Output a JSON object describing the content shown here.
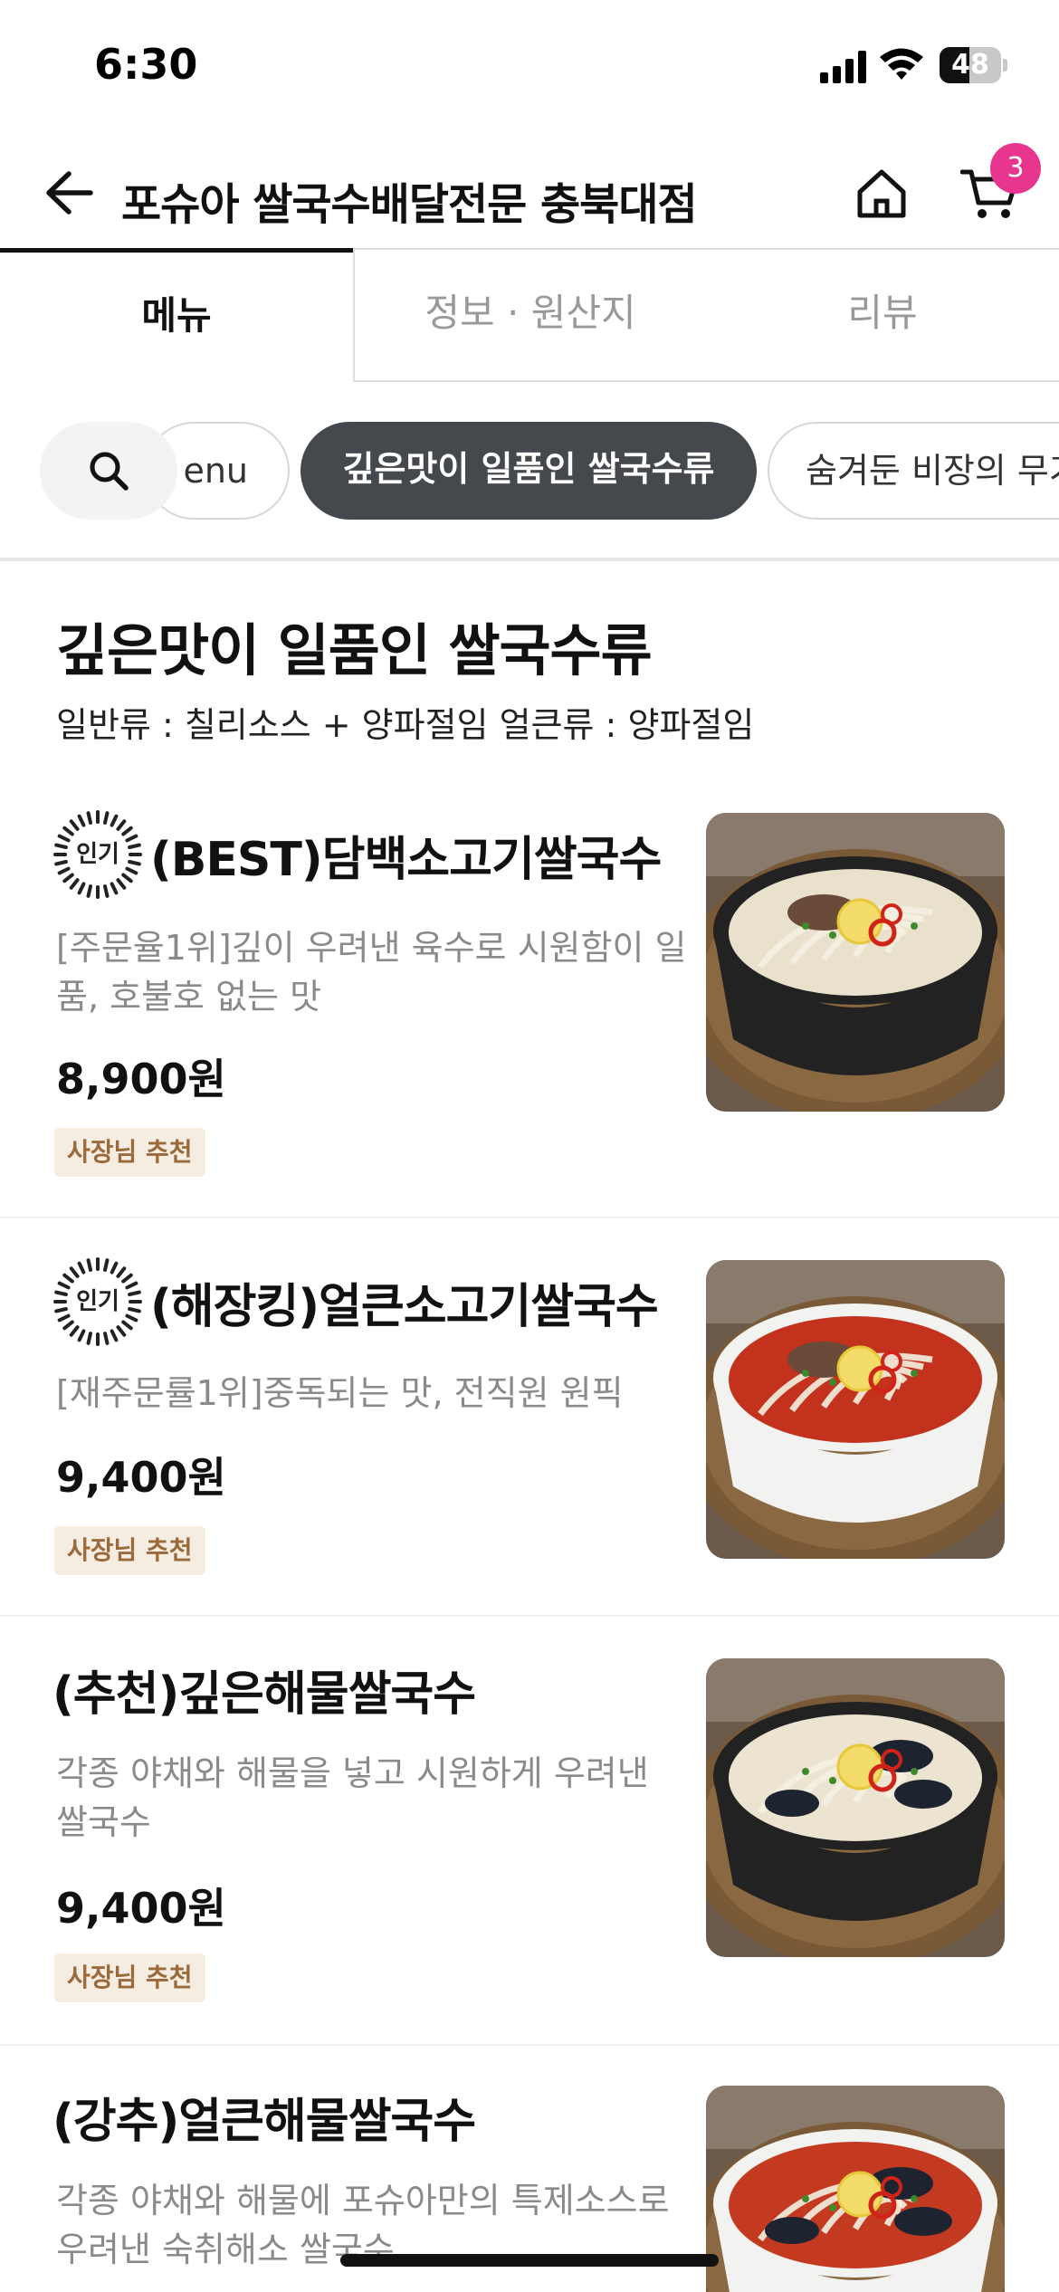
{
  "status_bar": {
    "time": "6:30",
    "battery": "48",
    "battery_level": 0.48
  },
  "header": {
    "store_name": "포슈아 쌀국수배달전문 충북대점",
    "cart_count": "3"
  },
  "tabs": [
    {
      "label": "메뉴",
      "active": true
    },
    {
      "label": "정보 · 원산지",
      "active": false
    },
    {
      "label": "리뷰",
      "active": false
    }
  ],
  "chips": {
    "prev_label": "enu",
    "active_label": "깊은맛이 일품인 쌀국수류",
    "next_label": "숨겨둔 비장의 무기"
  },
  "section": {
    "title": "깊은맛이 일품인 쌀국수류",
    "description": "일반류 : 칠리소스 + 양파절임 얼큰류 : 양파절임"
  },
  "menu_items": [
    {
      "popular": true,
      "popular_label": "인기",
      "name": "(BEST)담백소고기쌀국수",
      "description": "[주문율1위]깊이 우려낸 육수로 시원함이 일품, 호불호 없는 맛",
      "price": "8,900원",
      "badge": "사장님 추천",
      "broth": "clear"
    },
    {
      "popular": true,
      "popular_label": "인기",
      "name": "(해장킹)얼큰소고기쌀국수",
      "description": "[재주문률1위]중독되는 맛, 전직원 원픽",
      "price": "9,400원",
      "badge": "사장님 추천",
      "broth": "spicy"
    },
    {
      "popular": false,
      "name": "(추천)깊은해물쌀국수",
      "description": "각종 야채와 해물을 넣고 시원하게 우려낸 쌀국수",
      "price": "9,400원",
      "badge": "사장님 추천",
      "broth": "seafood"
    },
    {
      "popular": false,
      "name": "(강추)얼큰해물쌀국수",
      "description": "각종 야채와 해물에 포슈아만의 특제소스로 우려낸 숙취해소 쌀국수",
      "price": "",
      "badge": "",
      "broth": "spicy-seafood"
    }
  ],
  "colors": {
    "cart_badge": "#e8368f",
    "active_chip": "#45484d",
    "recommend_bg": "#f5ece2",
    "recommend_text": "#9a6a3a"
  },
  "icons": {
    "back": "arrow-left-icon",
    "home": "home-icon",
    "cart": "cart-icon",
    "search": "search-icon",
    "popular": "popular-badge-icon"
  }
}
